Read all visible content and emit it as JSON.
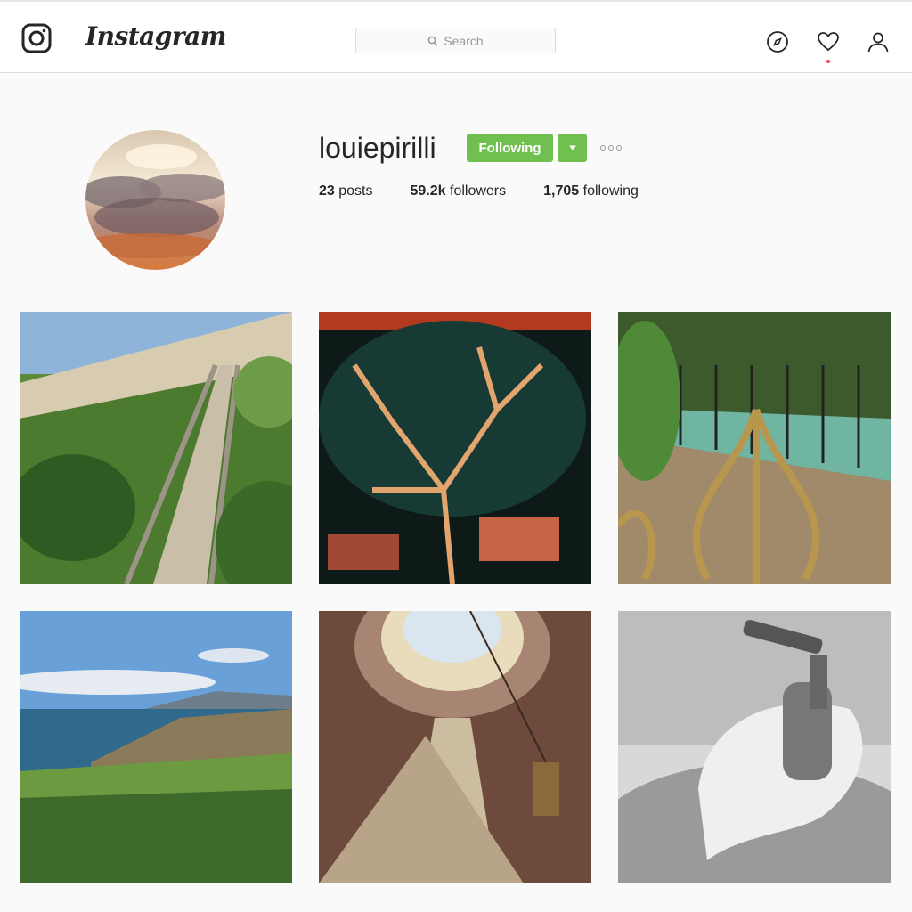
{
  "header": {
    "wordmark": "Instagram",
    "search": {
      "placeholder": "Search"
    }
  },
  "profile": {
    "username": "louiepirilli",
    "follow_label": "Following",
    "stats": [
      {
        "value": "23",
        "label": "posts"
      },
      {
        "value": "59.2k",
        "label": "followers"
      },
      {
        "value": "1,705",
        "label": "following"
      }
    ]
  },
  "icons": {
    "logo": "instagram-glyph-icon",
    "search": "search-icon",
    "explore": "compass-icon",
    "activity": "heart-icon",
    "profile": "person-icon",
    "dropdown": "caret-down-icon",
    "more": "more-options-icon"
  },
  "colors": {
    "follow_green": "#70c050",
    "notification_dot": "#ed4956",
    "background": "#fafafa"
  },
  "posts": [
    {
      "subject": "coastal stairway with railings"
    },
    {
      "subject": "painted tree against night sky"
    },
    {
      "subject": "ornate gold gate with black fence"
    },
    {
      "subject": "ocean coastline with cliffs"
    },
    {
      "subject": "dome interior with decorated tree"
    },
    {
      "subject": "black and white drinking fountain"
    }
  ]
}
